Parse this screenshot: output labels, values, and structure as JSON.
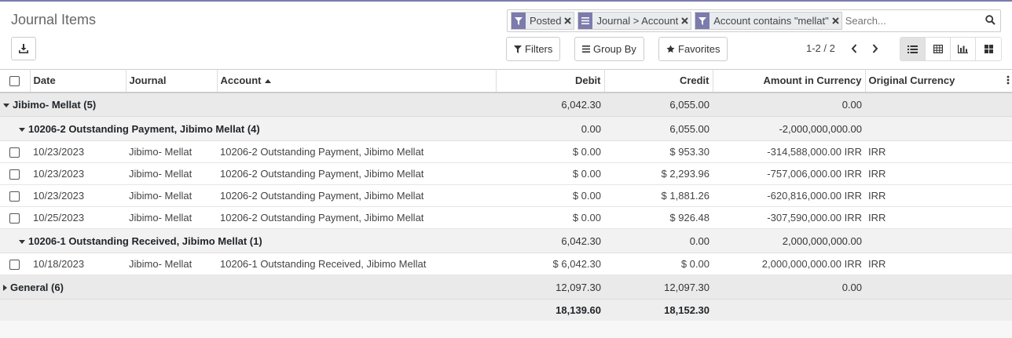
{
  "title": "Journal Items",
  "search": {
    "facets": [
      {
        "icon": "filter-icon",
        "label": "Posted"
      },
      {
        "icon": "group-by-icon",
        "label": "Journal > Account"
      },
      {
        "icon": "filter-icon",
        "label": "Account contains \"mellat\""
      }
    ],
    "placeholder": "Search..."
  },
  "controls": {
    "filters": "Filters",
    "group_by": "Group By",
    "favorites": "Favorites"
  },
  "pager": {
    "value": "1-2 / 2"
  },
  "views": [
    "list-view-icon",
    "pivot-view-icon",
    "graph-view-icon",
    "kanban-view-icon"
  ],
  "active_view": "list-view-icon",
  "columns": {
    "date": "Date",
    "journal": "Journal",
    "account": "Account",
    "debit": "Debit",
    "credit": "Credit",
    "amount_currency": "Amount in Currency",
    "currency": "Original Currency"
  },
  "groups": [
    {
      "label": "Jibimo- Mellat (5)",
      "debit": "6,042.30",
      "credit": "6,055.00",
      "amount": "0.00",
      "subgroups": [
        {
          "label": "10206-2 Outstanding Payment, Jibimo Mellat (4)",
          "debit": "0.00",
          "credit": "6,055.00",
          "amount": "-2,000,000,000.00",
          "rows": [
            {
              "date": "10/23/2023",
              "journal": "Jibimo- Mellat",
              "account": "10206-2 Outstanding Payment, Jibimo Mellat",
              "debit": "$ 0.00",
              "credit": "$ 953.30",
              "amount": "-314,588,000.00 IRR",
              "currency": "IRR"
            },
            {
              "date": "10/23/2023",
              "journal": "Jibimo- Mellat",
              "account": "10206-2 Outstanding Payment, Jibimo Mellat",
              "debit": "$ 0.00",
              "credit": "$ 2,293.96",
              "amount": "-757,006,000.00 IRR",
              "currency": "IRR"
            },
            {
              "date": "10/23/2023",
              "journal": "Jibimo- Mellat",
              "account": "10206-2 Outstanding Payment, Jibimo Mellat",
              "debit": "$ 0.00",
              "credit": "$ 1,881.26",
              "amount": "-620,816,000.00 IRR",
              "currency": "IRR"
            },
            {
              "date": "10/25/2023",
              "journal": "Jibimo- Mellat",
              "account": "10206-2 Outstanding Payment, Jibimo Mellat",
              "debit": "$ 0.00",
              "credit": "$ 926.48",
              "amount": "-307,590,000.00 IRR",
              "currency": "IRR"
            }
          ]
        },
        {
          "label": "10206-1 Outstanding Received, Jibimo Mellat (1)",
          "debit": "6,042.30",
          "credit": "0.00",
          "amount": "2,000,000,000.00",
          "rows": [
            {
              "date": "10/18/2023",
              "journal": "Jibimo- Mellat",
              "account": "10206-1 Outstanding Received, Jibimo Mellat",
              "debit": "$ 6,042.30",
              "credit": "$ 0.00",
              "amount": "2,000,000,000.00 IRR",
              "currency": "IRR"
            }
          ]
        }
      ]
    },
    {
      "label": "General (6)",
      "debit": "12,097.30",
      "credit": "12,097.30",
      "amount": "0.00",
      "collapsed": true
    }
  ],
  "totals": {
    "debit": "18,139.60",
    "credit": "18,152.30"
  },
  "colors": {
    "accent": "#7c7bad",
    "group_bg": "#eaeaea"
  }
}
